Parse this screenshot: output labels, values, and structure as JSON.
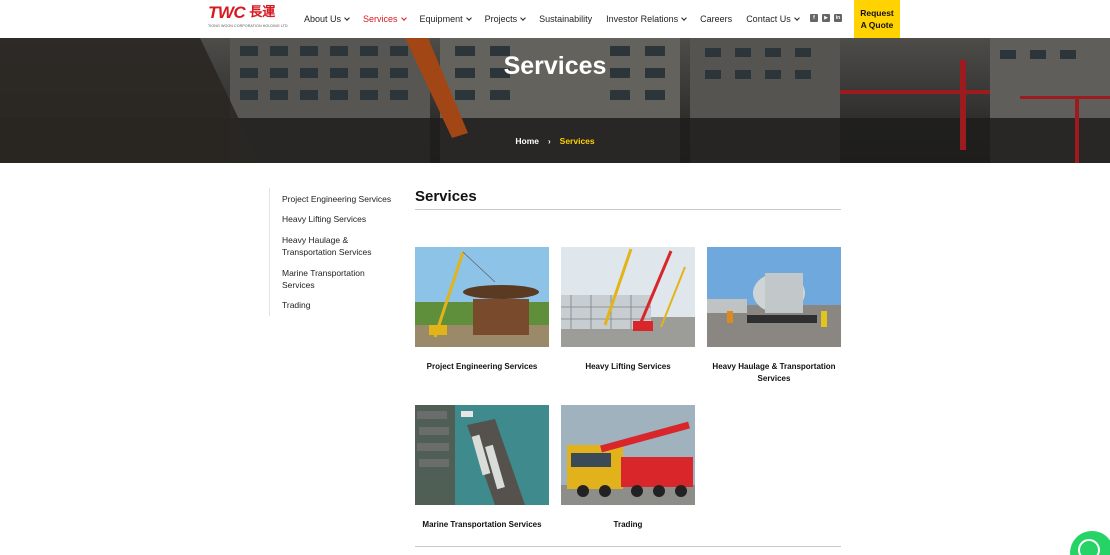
{
  "brand": {
    "logo_mark": "TWC",
    "logo_chinese": "長運",
    "logo_subtitle": "TIONG WOON CORPORATION HOLDING LTD",
    "accent": "#d71920",
    "highlight": "#ffd200"
  },
  "nav": {
    "items": [
      {
        "label": "About Us",
        "dropdown": true,
        "active": false
      },
      {
        "label": "Services",
        "dropdown": true,
        "active": true
      },
      {
        "label": "Equipment",
        "dropdown": true,
        "active": false
      },
      {
        "label": "Projects",
        "dropdown": true,
        "active": false
      },
      {
        "label": "Sustainability",
        "dropdown": false,
        "active": false
      },
      {
        "label": "Investor Relations",
        "dropdown": true,
        "active": false
      },
      {
        "label": "Careers",
        "dropdown": false,
        "active": false
      },
      {
        "label": "Contact Us",
        "dropdown": true,
        "active": false
      }
    ],
    "social": [
      "facebook-icon",
      "youtube-icon",
      "linkedin-icon"
    ],
    "quote_line1": "Request",
    "quote_line2": "A Quote"
  },
  "banner": {
    "title": "Services",
    "breadcrumb_home": "Home",
    "breadcrumb_separator": "›",
    "breadcrumb_current": "Services"
  },
  "sidebar": {
    "items": [
      "Project Engineering Services",
      "Heavy Lifting Services",
      "Heavy Haulage & Transportation Services",
      "Marine Transportation Services",
      "Trading"
    ]
  },
  "main": {
    "title": "Services",
    "cards": [
      {
        "label": "Project Engineering Services",
        "image": "crane-lifting-tank-roof-photo"
      },
      {
        "label": "Heavy Lifting Services",
        "image": "cranes-at-plant-structure-photo"
      },
      {
        "label": "Heavy Haulage & Transportation Services",
        "image": "vessel-on-transporter-photo"
      },
      {
        "label": "Marine Transportation Services",
        "image": "barge-aerial-photo"
      },
      {
        "label": "Trading",
        "image": "mobile-crane-truck-photo"
      }
    ]
  },
  "floating": {
    "whatsapp": "whatsapp-icon"
  }
}
